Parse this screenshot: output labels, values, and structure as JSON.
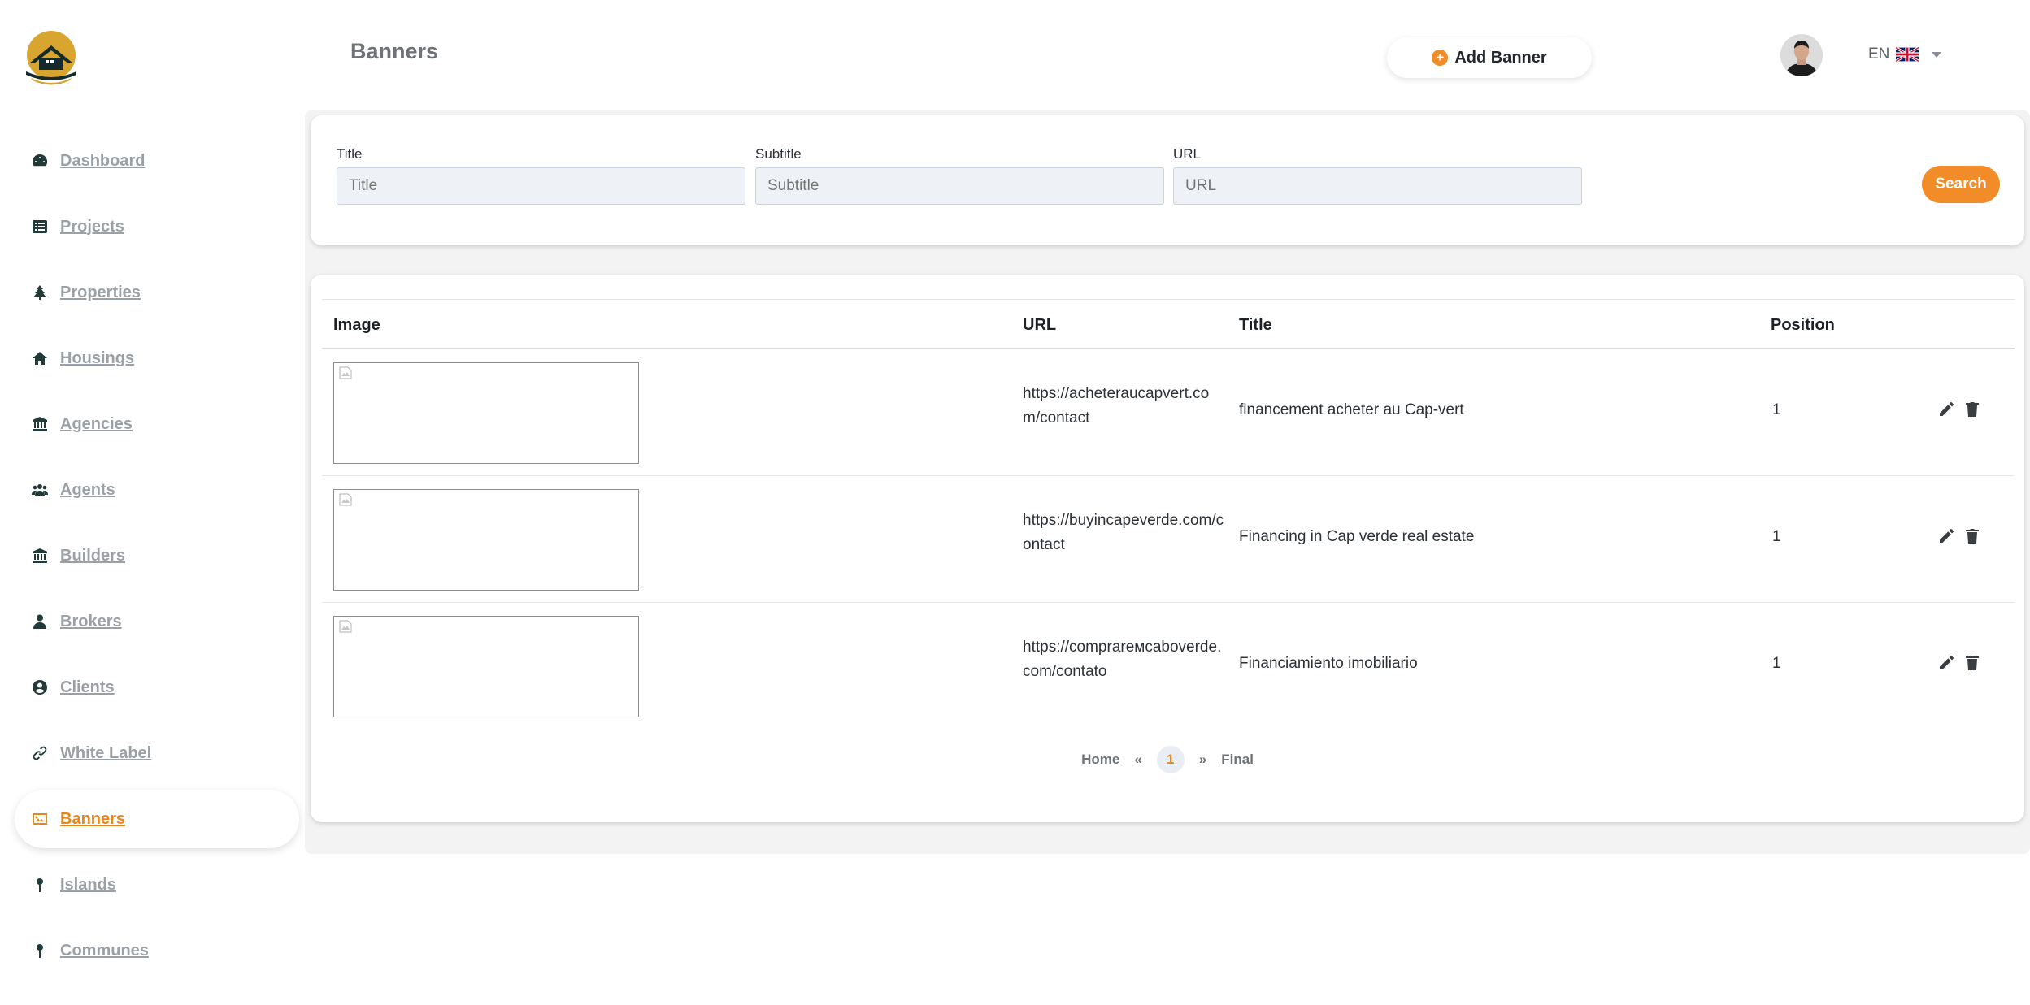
{
  "sidebar": {
    "items": [
      {
        "label": "Dashboard",
        "icon": "gauge-icon"
      },
      {
        "label": "Projects",
        "icon": "list-icon"
      },
      {
        "label": "Properties",
        "icon": "tree-icon"
      },
      {
        "label": "Housings",
        "icon": "home-icon"
      },
      {
        "label": "Agencies",
        "icon": "bank-icon"
      },
      {
        "label": "Agents",
        "icon": "users-icon"
      },
      {
        "label": "Builders",
        "icon": "bank-icon"
      },
      {
        "label": "Brokers",
        "icon": "user-icon"
      },
      {
        "label": "Clients",
        "icon": "user-circle-icon"
      },
      {
        "label": "White Label",
        "icon": "link-icon"
      },
      {
        "label": "Banners",
        "icon": "image-icon",
        "active": true
      },
      {
        "label": "Islands",
        "icon": "pin-icon"
      },
      {
        "label": "Communes",
        "icon": "pin-icon"
      }
    ]
  },
  "header": {
    "title": "Banners",
    "add_button": "Add Banner",
    "language": "EN"
  },
  "filters": {
    "title": {
      "label": "Title",
      "placeholder": "Title",
      "value": ""
    },
    "subtitle": {
      "label": "Subtitle",
      "placeholder": "Subtitle",
      "value": ""
    },
    "url": {
      "label": "URL",
      "placeholder": "URL",
      "value": ""
    },
    "search_button": "Search"
  },
  "table": {
    "columns": [
      "Image",
      "URL",
      "Title",
      "Position"
    ],
    "rows": [
      {
        "url": "https://acheteraucapvert.com/contact",
        "title": "financement acheter au Cap-vert",
        "position": "1"
      },
      {
        "url": "https://buyincapeverde.com/contact",
        "title": "Financing in Cap verde real estate",
        "position": "1"
      },
      {
        "url": "https://comprarемcaboverde.com/contato",
        "title": "Financiamiento imobiliario",
        "position": "1"
      }
    ]
  },
  "pagination": {
    "first": "Home",
    "prev": "«",
    "current": "1",
    "next": "»",
    "last": "Final"
  },
  "colors": {
    "accent": "#f28c28",
    "active_text": "#e8861e",
    "icon_dark": "#223a3a"
  }
}
